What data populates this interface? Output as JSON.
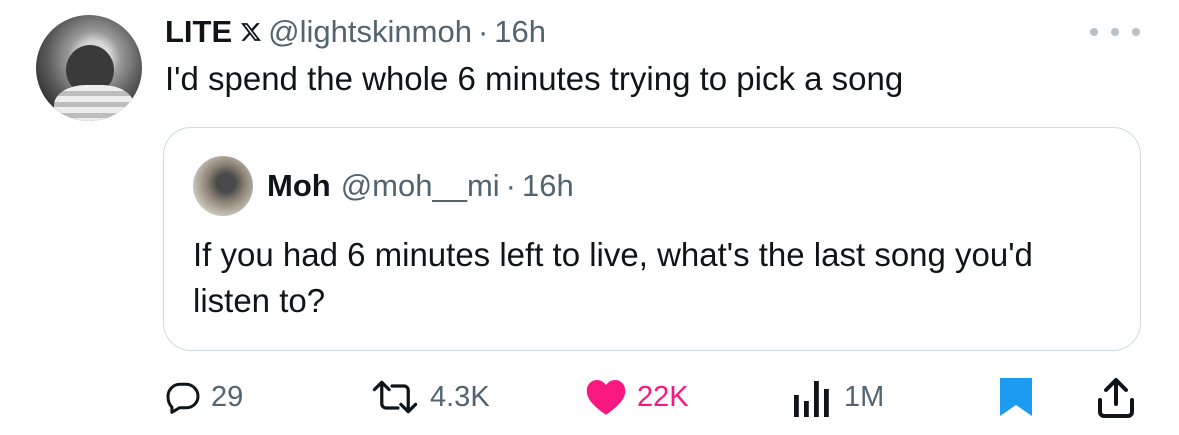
{
  "tweet": {
    "display_name": "LITE",
    "handle": "@lightskinmoh",
    "separator": "·",
    "time": "16h",
    "text": "I'd spend the whole 6 minutes trying to pick a song",
    "platform_icon": "x-logo-icon",
    "more_icon": "more-icon"
  },
  "quote": {
    "display_name": "Moh",
    "handle": "@moh__mi",
    "separator": "·",
    "time": "16h",
    "text": "If you had 6 minutes left to live, what's the last song you'd listen to?"
  },
  "actions": {
    "replies": "29",
    "reposts": "4.3K",
    "likes": "22K",
    "views": "1M",
    "liked": true,
    "bookmarked": true
  },
  "colors": {
    "text_primary": "#0f1419",
    "text_secondary": "#536471",
    "like": "#f91880",
    "bookmark": "#1d9bf0",
    "border": "#cfd9de"
  }
}
